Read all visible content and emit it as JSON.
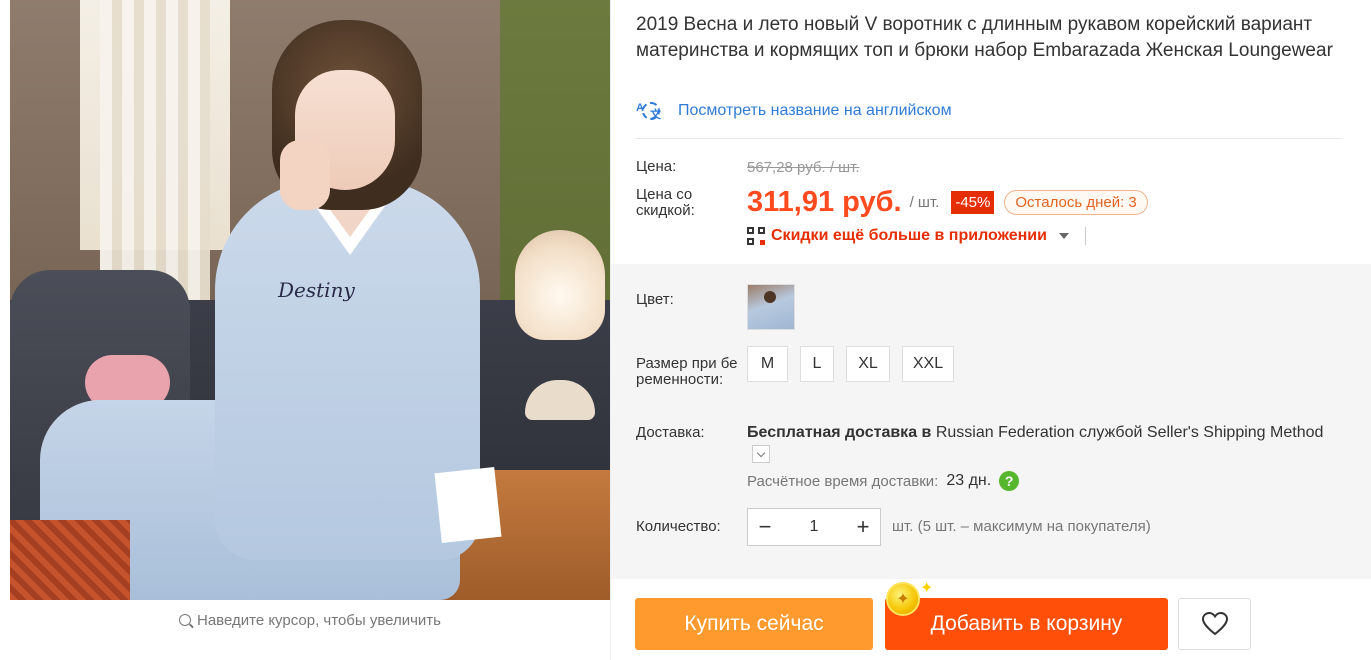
{
  "gallery": {
    "image_print_text": "Destiny",
    "zoom_hint": "Наведите курсор, чтобы увеличить"
  },
  "product": {
    "title": "2019 Весна и лето новый V воротник с длинным рукавом корейский вариант материнства и кормящих топ и брюки набор Embarazada Женская Loungewear",
    "translate_link": "Посмотреть название на английском"
  },
  "pricing": {
    "price_label": "Цена:",
    "old_price": "567,28 руб. / шт.",
    "discount_price_label": "Цена со скидкой:",
    "price": "311,91 руб.",
    "per_unit": "/ шт.",
    "discount_badge": "-45%",
    "days_left": "Осталось дней: 3",
    "app_promo": "Скидки ещё больше в приложении"
  },
  "sku": {
    "color_label": "Цвет:",
    "size_label": "Размер при беременности:",
    "sizes": [
      "M",
      "L",
      "XL",
      "XXL"
    ]
  },
  "shipping": {
    "label": "Доставка:",
    "free_text": "Бесплатная доставка в",
    "country": "Russian Federation",
    "via": "службой",
    "method": "Seller's Shipping Method",
    "eta_label": "Расчётное время доставки:",
    "eta_value": "23 дн."
  },
  "quantity": {
    "label": "Количество:",
    "minus": "−",
    "value": "1",
    "plus": "+",
    "note": "шт. (5 шт. – максимум на покупателя)"
  },
  "actions": {
    "buy_now": "Купить сейчас",
    "add_to_cart": "Добавить в корзину"
  },
  "colors": {
    "price": "#ff4a1f",
    "discount_badge": "#e62e04",
    "buy_button": "#ff9a2f",
    "cart_button": "#ff4f08",
    "link": "#2f7bd6",
    "help_icon": "#56b62e"
  },
  "icons": {
    "translate": "translate-icon",
    "qr": "qr-icon",
    "search": "magnifier-icon",
    "help": "question-icon",
    "wishlist": "heart-icon",
    "coin": "coin-icon"
  }
}
